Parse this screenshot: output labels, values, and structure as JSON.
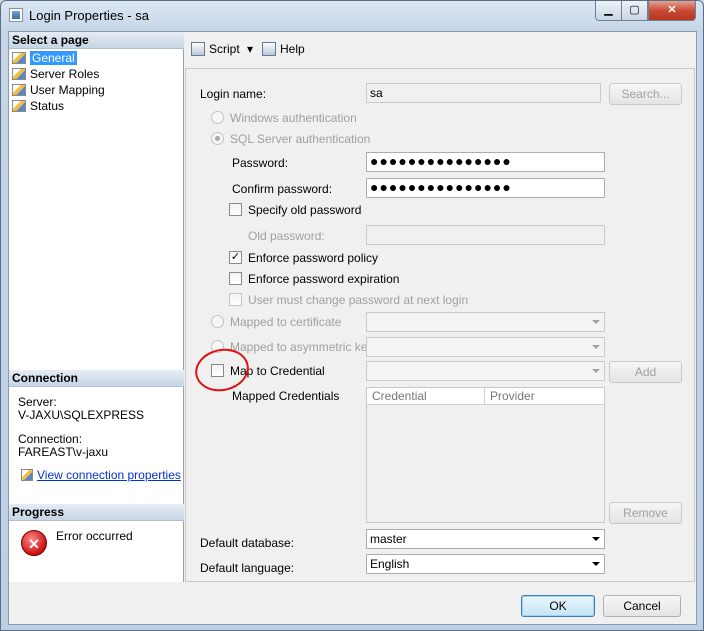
{
  "window": {
    "title": "Login Properties - sa",
    "min_label": "▁",
    "max_label": "▢",
    "close_label": "✕"
  },
  "left": {
    "select_page_title": "Select a page",
    "pages": [
      "General",
      "Server Roles",
      "User Mapping",
      "Status"
    ],
    "connection_title": "Connection",
    "server_label": "Server:",
    "server_value": "V-JAXU\\SQLEXPRESS",
    "connection_label": "Connection:",
    "connection_value": "FAREAST\\v-jaxu",
    "view_link": "View connection properties",
    "progress_title": "Progress",
    "progress_status": "Error occurred"
  },
  "toolbar": {
    "script_label": "Script",
    "help_label": "Help",
    "dropdown_arrow": "▾"
  },
  "form": {
    "login_name_label": "Login name:",
    "login_name_value": "sa",
    "search_label": "Search...",
    "windows_auth_label": "Windows authentication",
    "sql_auth_label": "SQL Server authentication",
    "password_label": "Password:",
    "password_value": "●●●●●●●●●●●●●●●",
    "confirm_password_label": "Confirm password:",
    "confirm_password_value": "●●●●●●●●●●●●●●●",
    "specify_old_label": "Specify old password",
    "old_password_label": "Old password:",
    "enforce_policy_label": "Enforce password policy",
    "enforce_policy_checked": true,
    "enforce_expiration_label": "Enforce password expiration",
    "must_change_label": "User must change password at next login",
    "mapped_cert_label": "Mapped to certificate",
    "mapped_asym_label": "Mapped to asymmetric key",
    "map_credential_label": "Map to Credential",
    "add_label": "Add",
    "mapped_credentials_label": "Mapped Credentials",
    "grid_headers": [
      "Credential",
      "Provider"
    ],
    "remove_label": "Remove",
    "default_db_label": "Default database:",
    "default_db_value": "master",
    "default_lang_label": "Default language:",
    "default_lang_value": "English",
    "check_mark": "✓",
    "ok_label": "OK",
    "cancel_label": "Cancel"
  },
  "colors": {
    "selection": "#3399ff",
    "annotation": "#e01010",
    "error": "#cc1010"
  },
  "icons": [
    "app-icon",
    "page-icon",
    "script-icon",
    "help-icon",
    "error-icon",
    "dropdown-arrow-icon"
  ]
}
